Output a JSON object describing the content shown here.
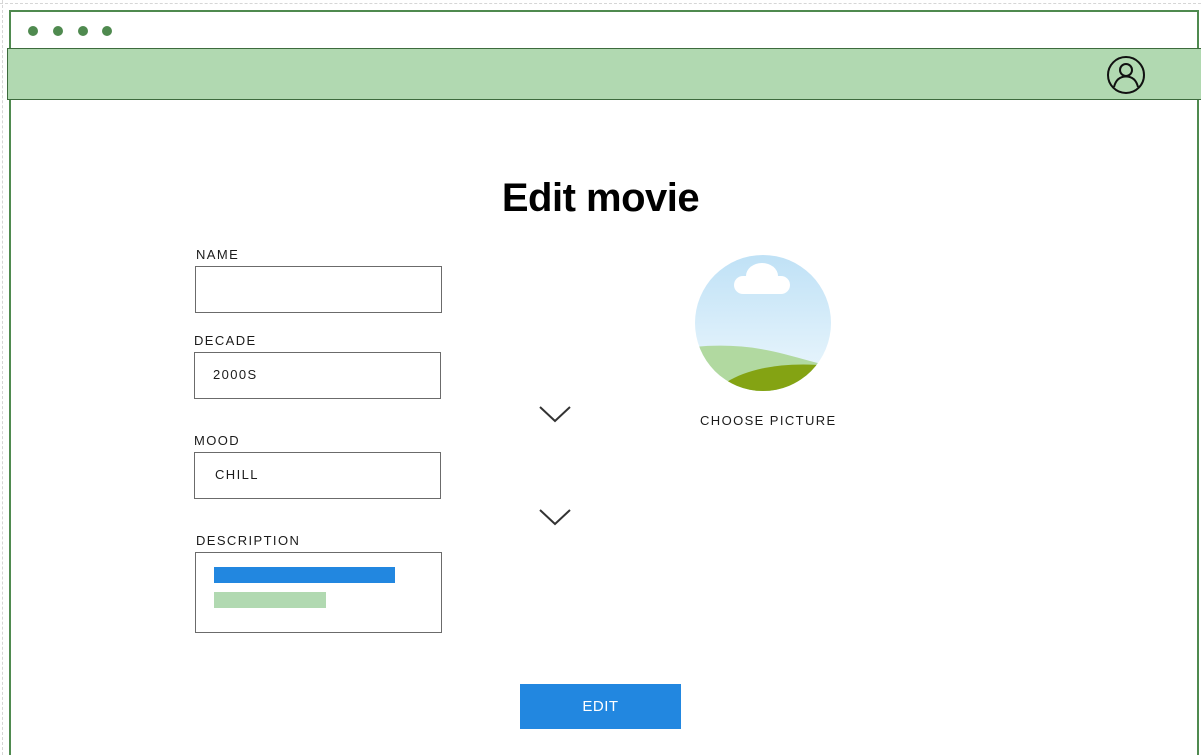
{
  "page": {
    "title": "Edit movie"
  },
  "form": {
    "name": {
      "label": "NAME",
      "value": ""
    },
    "decade": {
      "label": "DECADE",
      "value": "2000S"
    },
    "mood": {
      "label": "MOOD",
      "value": "CHILL"
    },
    "description": {
      "label": "DESCRIPTION"
    }
  },
  "picture": {
    "label": "CHOOSE PICTURE"
  },
  "actions": {
    "edit_label": "EDIT"
  },
  "icons": {
    "account": "user-circle-icon",
    "dropdown": "chevron-down-icon",
    "image": "landscape-image-icon"
  },
  "colors": {
    "frame": "#4f8a4f",
    "navbar": "#b1d9b1",
    "primary": "#2287e0",
    "placeholder_line_1": "#2287e0",
    "placeholder_line_2": "#b1d9b1"
  }
}
